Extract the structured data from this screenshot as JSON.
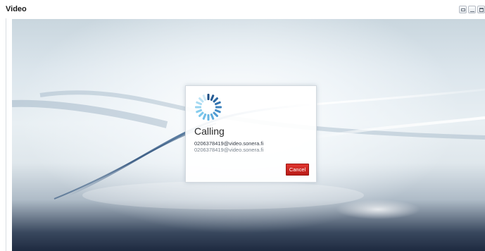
{
  "window": {
    "title": "Video",
    "controls": [
      {
        "name": "restore",
        "icon": "restore-icon"
      },
      {
        "name": "minimize",
        "icon": "minimize-icon"
      },
      {
        "name": "maximize",
        "icon": "maximize-icon"
      }
    ]
  },
  "call_dialog": {
    "spinner_icon": "loading-spinner-icon",
    "status": "Calling",
    "address_primary": "0206378419@video.sonera.fi",
    "address_secondary": "0206378419@video.sonera.fi",
    "cancel_label": "Cancel"
  },
  "colors": {
    "cancel_button": "#c8231e",
    "spinner_dark": "#1d4d84",
    "spinner_light": "#78c6ec"
  }
}
